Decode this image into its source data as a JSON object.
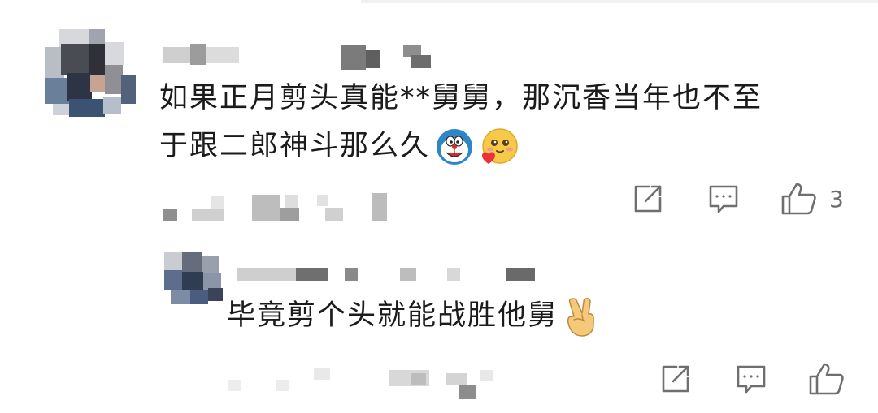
{
  "comment": {
    "text_line_1": "如果正月剪头真能**舅舅，那沉香当年也不至",
    "text_line_2": "于跟二郎神斗那么久",
    "emojis": [
      "doraemon-emoji",
      "blushing-heart-emoji"
    ],
    "like_count": "3",
    "icons": {
      "share": "share-icon",
      "reply": "comment-icon",
      "like": "thumbs-up-icon"
    }
  },
  "reply": {
    "text": "毕竟剪个头就能战胜他舅",
    "emojis": [
      "victory-hand-emoji"
    ],
    "icons": {
      "share": "share-icon",
      "reply": "comment-icon",
      "like": "thumbs-up-icon"
    }
  },
  "colors": {
    "text": "#1b1b1b",
    "icon": "#6f6f6f",
    "mosaic_light": "#e6e6e6",
    "mosaic_mid": "#b9b9b9",
    "mosaic_dark": "#5e5e5e",
    "avatar_blue": "#354b68"
  }
}
